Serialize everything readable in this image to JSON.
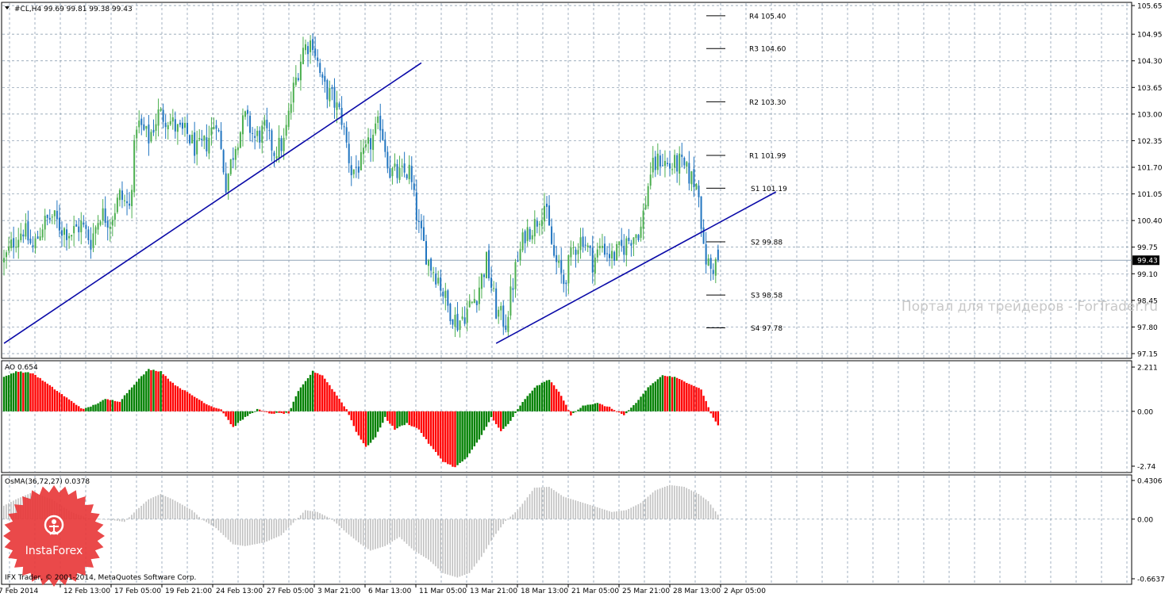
{
  "header": {
    "symbol_info": "#CL,H4  99.69 99.81 99.38 99.43"
  },
  "chart_data": [
    {
      "type": "candlestick",
      "title": "#CL,H4",
      "ohlc": {
        "open": 99.69,
        "high": 99.81,
        "low": 99.38,
        "close": 99.43
      },
      "ylim": [
        97.15,
        105.65
      ],
      "y_ticks": [
        "105.65",
        "104.95",
        "104.30",
        "103.65",
        "103.00",
        "102.35",
        "101.70",
        "101.05",
        "100.40",
        "99.75",
        "99.10",
        "98.45",
        "97.80",
        "97.15"
      ],
      "current_price": "99.43",
      "pivot_levels": [
        {
          "label": "R4 105.40",
          "value": 105.4
        },
        {
          "label": "R3 104.60",
          "value": 104.6
        },
        {
          "label": "R2 103.30",
          "value": 103.3
        },
        {
          "label": "R1 101.99",
          "value": 101.99
        },
        {
          "label": "S1 101.19",
          "value": 101.19
        },
        {
          "label": "S2 99.88",
          "value": 99.88
        },
        {
          "label": "S3 98.58",
          "value": 98.58
        },
        {
          "label": "S4 97.78",
          "value": 97.78
        }
      ],
      "trendlines": [
        {
          "from": [
            0,
            97.4
          ],
          "to": [
            173,
            104.25
          ]
        },
        {
          "from": [
            204,
            97.4
          ],
          "to": [
            320,
            101.1
          ]
        }
      ],
      "close_path": [
        [
          0,
          99.4
        ],
        [
          4,
          99.9
        ],
        [
          8,
          100.2
        ],
        [
          12,
          99.7
        ],
        [
          16,
          100.3
        ],
        [
          20,
          100.5
        ],
        [
          24,
          100.2
        ],
        [
          28,
          100.1
        ],
        [
          32,
          100.3
        ],
        [
          36,
          99.9
        ],
        [
          40,
          100.6
        ],
        [
          44,
          100.4
        ],
        [
          48,
          101.0
        ],
        [
          52,
          100.7
        ],
        [
          55,
          102.8
        ],
        [
          60,
          102.4
        ],
        [
          64,
          103.0
        ],
        [
          68,
          102.9
        ],
        [
          72,
          102.6
        ],
        [
          76,
          102.5
        ],
        [
          80,
          102.1
        ],
        [
          84,
          102.3
        ],
        [
          88,
          102.9
        ],
        [
          92,
          101.3
        ],
        [
          96,
          102.3
        ],
        [
          100,
          102.9
        ],
        [
          104,
          102.4
        ],
        [
          108,
          102.6
        ],
        [
          112,
          102.1
        ],
        [
          116,
          102.3
        ],
        [
          120,
          103.6
        ],
        [
          124,
          104.6
        ],
        [
          128,
          104.8
        ],
        [
          132,
          103.7
        ],
        [
          136,
          103.4
        ],
        [
          140,
          102.9
        ],
        [
          144,
          101.6
        ],
        [
          148,
          101.8
        ],
        [
          152,
          102.3
        ],
        [
          156,
          102.8
        ],
        [
          160,
          101.6
        ],
        [
          164,
          101.5
        ],
        [
          168,
          101.6
        ],
        [
          172,
          100.2
        ],
        [
          176,
          99.4
        ],
        [
          180,
          99.0
        ],
        [
          184,
          98.3
        ],
        [
          188,
          97.9
        ],
        [
          192,
          98.2
        ],
        [
          196,
          98.6
        ],
        [
          200,
          99.4
        ],
        [
          204,
          98.2
        ],
        [
          208,
          97.9
        ],
        [
          212,
          99.2
        ],
        [
          216,
          100.1
        ],
        [
          220,
          100.3
        ],
        [
          224,
          100.8
        ],
        [
          228,
          99.5
        ],
        [
          232,
          98.9
        ],
        [
          236,
          99.7
        ],
        [
          240,
          100.0
        ],
        [
          244,
          99.4
        ],
        [
          248,
          99.8
        ],
        [
          252,
          99.5
        ],
        [
          256,
          99.7
        ],
        [
          260,
          100.0
        ],
        [
          264,
          100.2
        ],
        [
          268,
          101.6
        ],
        [
          272,
          101.9
        ],
        [
          276,
          101.7
        ],
        [
          280,
          101.8
        ],
        [
          284,
          101.5
        ],
        [
          288,
          101.2
        ],
        [
          290,
          99.6
        ],
        [
          293,
          99.2
        ],
        [
          296,
          99.43
        ]
      ]
    },
    {
      "type": "histogram",
      "title": "AO 0.654",
      "indicator": "AO",
      "last_value": 0.654,
      "ylim": [
        -2.74,
        2.211
      ],
      "y_ticks": [
        "2.211",
        "0.00",
        "-2.74"
      ],
      "colors": {
        "up": "#008000",
        "down": "#ff0000"
      },
      "path": [
        [
          0,
          1.7
        ],
        [
          5,
          2.0
        ],
        [
          12,
          1.9
        ],
        [
          20,
          1.2
        ],
        [
          28,
          0.5
        ],
        [
          33,
          0.1
        ],
        [
          37,
          0.3
        ],
        [
          42,
          0.6
        ],
        [
          48,
          0.5
        ],
        [
          55,
          1.5
        ],
        [
          60,
          2.1
        ],
        [
          65,
          2.0
        ],
        [
          70,
          1.4
        ],
        [
          78,
          0.8
        ],
        [
          85,
          0.3
        ],
        [
          90,
          0.1
        ],
        [
          95,
          -0.8
        ],
        [
          100,
          -0.3
        ],
        [
          105,
          0.1
        ],
        [
          110,
          -0.1
        ],
        [
          118,
          -0.1
        ],
        [
          122,
          1.0
        ],
        [
          128,
          2.0
        ],
        [
          132,
          1.8
        ],
        [
          138,
          0.8
        ],
        [
          142,
          0.1
        ],
        [
          146,
          -1.0
        ],
        [
          150,
          -1.8
        ],
        [
          154,
          -1.3
        ],
        [
          158,
          -0.3
        ],
        [
          162,
          -0.9
        ],
        [
          167,
          -0.6
        ],
        [
          172,
          -0.9
        ],
        [
          176,
          -1.6
        ],
        [
          182,
          -2.5
        ],
        [
          187,
          -2.8
        ],
        [
          192,
          -2.3
        ],
        [
          197,
          -1.4
        ],
        [
          202,
          -0.3
        ],
        [
          206,
          -1.0
        ],
        [
          210,
          -0.5
        ],
        [
          214,
          0.3
        ],
        [
          220,
          1.2
        ],
        [
          226,
          1.6
        ],
        [
          231,
          0.8
        ],
        [
          235,
          -0.2
        ],
        [
          240,
          0.3
        ],
        [
          246,
          0.4
        ],
        [
          251,
          0.2
        ],
        [
          257,
          -0.2
        ],
        [
          262,
          0.4
        ],
        [
          267,
          1.2
        ],
        [
          273,
          1.8
        ],
        [
          278,
          1.7
        ],
        [
          284,
          1.4
        ],
        [
          289,
          1.1
        ],
        [
          293,
          -0.1
        ],
        [
          296,
          -0.7
        ]
      ]
    },
    {
      "type": "histogram",
      "title": "OsMA(36,72,27) 0.0378",
      "indicator": "OsMA(36,72,27)",
      "last_value": 0.0378,
      "ylim": [
        -0.6637,
        0.4306
      ],
      "y_ticks": [
        "0.4306",
        "0.00",
        "-0.6637"
      ],
      "colors": {
        "bar": "#c0c0c0"
      },
      "path": [
        [
          0,
          0.15
        ],
        [
          5,
          0.22
        ],
        [
          12,
          0.3
        ],
        [
          20,
          0.22
        ],
        [
          28,
          0.08
        ],
        [
          35,
          0.01
        ],
        [
          42,
          0.0
        ],
        [
          50,
          -0.03
        ],
        [
          55,
          0.1
        ],
        [
          60,
          0.22
        ],
        [
          65,
          0.28
        ],
        [
          70,
          0.22
        ],
        [
          78,
          0.1
        ],
        [
          82,
          0.0
        ],
        [
          88,
          -0.1
        ],
        [
          95,
          -0.28
        ],
        [
          100,
          -0.3
        ],
        [
          108,
          -0.26
        ],
        [
          115,
          -0.18
        ],
        [
          120,
          -0.04
        ],
        [
          125,
          0.1
        ],
        [
          130,
          0.08
        ],
        [
          136,
          0.0
        ],
        [
          142,
          -0.15
        ],
        [
          148,
          -0.28
        ],
        [
          152,
          -0.35
        ],
        [
          158,
          -0.3
        ],
        [
          164,
          -0.2
        ],
        [
          170,
          -0.35
        ],
        [
          176,
          -0.45
        ],
        [
          182,
          -0.6
        ],
        [
          188,
          -0.65
        ],
        [
          193,
          -0.6
        ],
        [
          198,
          -0.42
        ],
        [
          203,
          -0.2
        ],
        [
          208,
          -0.02
        ],
        [
          213,
          0.1
        ],
        [
          220,
          0.35
        ],
        [
          226,
          0.36
        ],
        [
          232,
          0.25
        ],
        [
          238,
          0.2
        ],
        [
          244,
          0.15
        ],
        [
          252,
          0.08
        ],
        [
          258,
          0.1
        ],
        [
          264,
          0.18
        ],
        [
          270,
          0.32
        ],
        [
          276,
          0.38
        ],
        [
          282,
          0.36
        ],
        [
          288,
          0.28
        ],
        [
          292,
          0.2
        ],
        [
          296,
          0.05
        ]
      ]
    }
  ],
  "time_axis": {
    "labels": [
      "7 Feb 2014",
      "12 Feb 13:00",
      "17 Feb 05:00",
      "19 Feb 21:00",
      "24 Feb 13:00",
      "27 Feb 05:00",
      "3 Mar 21:00",
      "6 Mar 13:00",
      "11 Mar 05:00",
      "13 Mar 21:00",
      "18 Mar 13:00",
      "21 Mar 05:00",
      "25 Mar 21:00",
      "28 Mar 13:00",
      "2 Apr 05:00"
    ]
  },
  "watermark": "Портал для трейдеров - ForTrader.ru",
  "logo": {
    "text": "InstaForex"
  },
  "copyright": "IFX Trader, © 2001-2014, MetaQuotes Software Corp.",
  "colors": {
    "bull": "#4caf50",
    "bear": "#2175c0",
    "trendline": "#0a0aa8",
    "grid": "#7d92a6",
    "axis": "#000000",
    "logo": "#e8393b"
  }
}
